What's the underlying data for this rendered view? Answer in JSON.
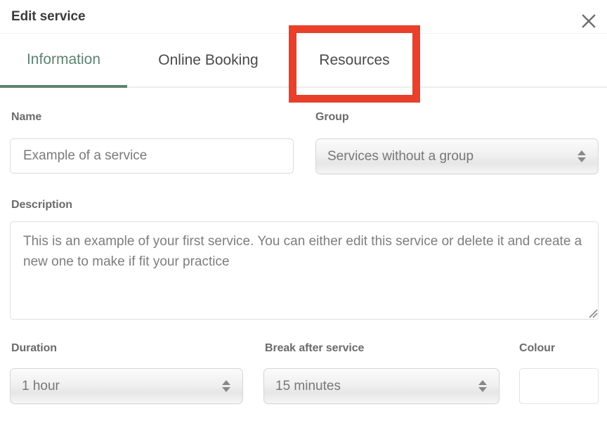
{
  "header": {
    "title": "Edit service",
    "close_icon": "close-icon"
  },
  "tabs": [
    {
      "label": "Information",
      "active": true
    },
    {
      "label": "Online Booking",
      "active": false
    },
    {
      "label": "Resources",
      "active": false
    }
  ],
  "annotation": {
    "target": "Resources",
    "color": "#e8402a"
  },
  "form": {
    "name": {
      "label": "Name",
      "value": "Example of a service",
      "placeholder": "Example of a service"
    },
    "group": {
      "label": "Group",
      "value": "Services without a group"
    },
    "description": {
      "label": "Description",
      "value": "This is an example of your first service. You can either edit this service or delete it and create a new one to make if fit your practice"
    },
    "duration": {
      "label": "Duration",
      "value": "1 hour"
    },
    "break_after_service": {
      "label": "Break after service",
      "value": "15 minutes"
    },
    "colour": {
      "label": "Colour",
      "value": ""
    }
  },
  "theme": {
    "accent": "#5c836d",
    "label_color": "#6b6b6b",
    "title_color": "#3b3b3b",
    "highlight": "#e8402a"
  }
}
